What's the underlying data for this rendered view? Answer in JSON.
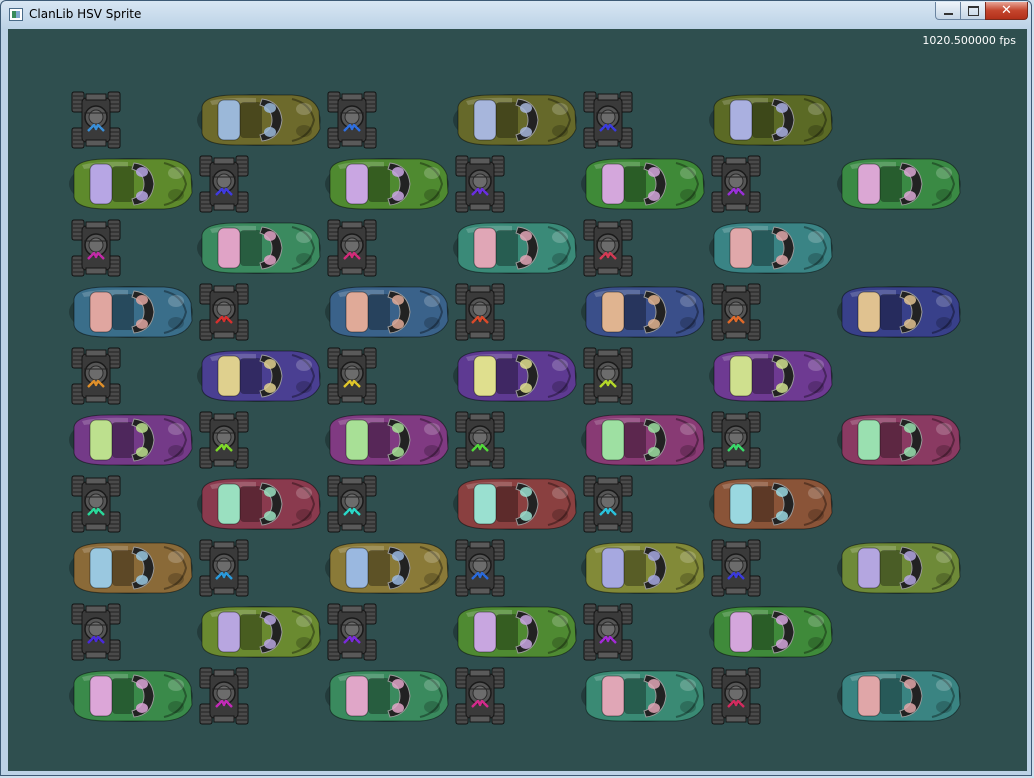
{
  "window": {
    "title": "ClanLib HSV Sprite",
    "controls": {
      "minimize": "minimize",
      "maximize": "maximize",
      "close": "close"
    }
  },
  "overlay": {
    "fps_text": "1020.500000 fps"
  },
  "sprites": {
    "car_icon": "sports-car-top-view",
    "buggy_icon": "dune-buggy-top-view",
    "rows": [
      {
        "car_colors": [
          "#6d6a2c",
          "#66692a",
          "#5b6a25"
        ],
        "cabin": [
          "#9bb8d9",
          "#a7b6dc",
          "#aab0e0"
        ],
        "buggy_accent": [
          "#3a8fd8",
          "#2f6fe0",
          "#3a3adf"
        ]
      },
      {
        "car_colors": [
          "#5e8a2c",
          "#4f8a30",
          "#3f8a38",
          "#3a8a44"
        ],
        "cabin": [
          "#b7a6e4",
          "#c9a6e2",
          "#d4a7dc",
          "#dba7d4"
        ],
        "buggy_accent": [
          "#3f3ae0",
          "#6a2fe0",
          "#9a30d8"
        ]
      },
      {
        "car_colors": [
          "#3b8a5f",
          "#3a8a78",
          "#3a8485"
        ],
        "cabin": [
          "#e0a3c6",
          "#e0a6b6",
          "#e0a8aa"
        ],
        "buggy_accent": [
          "#c32aa8",
          "#d42a7a",
          "#d43a54"
        ]
      },
      {
        "car_colors": [
          "#3a6e8a",
          "#3a628a",
          "#3a4f8a",
          "#38408a"
        ],
        "cabin": [
          "#e0a6a0",
          "#e0aa98",
          "#e0b490",
          "#e0c290"
        ],
        "buggy_accent": [
          "#d8302e",
          "#dc4a2a",
          "#e06a2a"
        ]
      },
      {
        "car_colors": [
          "#4a3f92",
          "#5e3a92",
          "#6e3a92"
        ],
        "cabin": [
          "#dfd08e",
          "#dfdf8e",
          "#cfe08e"
        ],
        "buggy_accent": [
          "#e0902a",
          "#dfc52a",
          "#b5d82a"
        ]
      },
      {
        "car_colors": [
          "#743a88",
          "#803a82",
          "#883a74",
          "#8a3a62"
        ],
        "cabin": [
          "#bde08e",
          "#a8e096",
          "#9ee0a2",
          "#9ae0b0"
        ],
        "buggy_accent": [
          "#7fd82a",
          "#52d83a",
          "#3ad86a"
        ]
      },
      {
        "car_colors": [
          "#8a3a4e",
          "#8a4040",
          "#8a5438"
        ],
        "cabin": [
          "#9ae0c0",
          "#9ae0d0",
          "#9ad8e0"
        ],
        "buggy_accent": [
          "#2ad89a",
          "#2ad8c8",
          "#2ac2dc"
        ]
      },
      {
        "car_colors": [
          "#8a6a38",
          "#8a7a38",
          "#828a38",
          "#6e8a38"
        ],
        "cabin": [
          "#9ac8e0",
          "#9ab8e0",
          "#a6a8e0",
          "#b4a6e0"
        ],
        "buggy_accent": [
          "#2a9adc",
          "#2a6adc",
          "#3a3adc"
        ]
      },
      {
        "car_colors": [
          "#6a8a30",
          "#4f8a32",
          "#3f8a3a"
        ],
        "cabin": [
          "#b8a6e0",
          "#c8a6e0",
          "#d4a6dc"
        ],
        "buggy_accent": [
          "#4a2adc",
          "#7a2adc",
          "#a42ad8"
        ]
      },
      {
        "car_colors": [
          "#3a8a4a",
          "#3a8a5e",
          "#3a8a74",
          "#3a8482"
        ],
        "cabin": [
          "#dca6d8",
          "#e0a6c8",
          "#e0a6b6",
          "#e0a6a8"
        ],
        "buggy_accent": [
          "#c42ab8",
          "#d42a8c",
          "#d42a5e"
        ]
      }
    ]
  }
}
